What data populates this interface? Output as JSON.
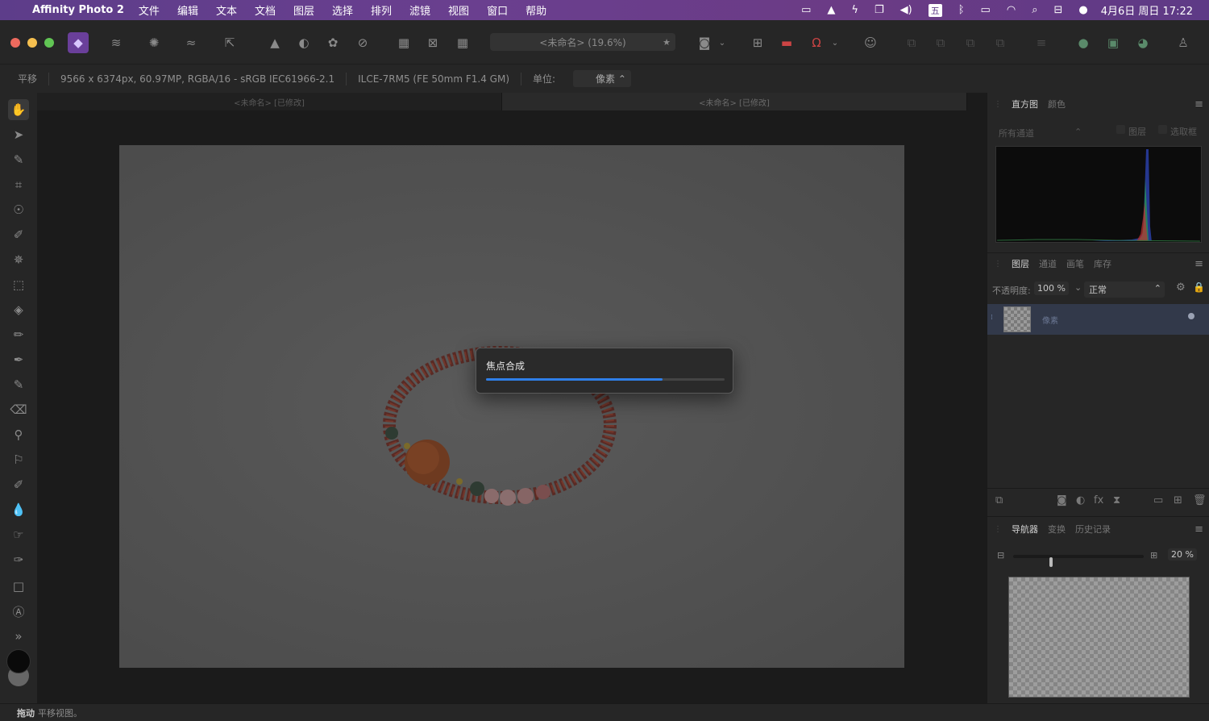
{
  "menubar": {
    "app_name": "Affinity Photo 2",
    "items": [
      "文件",
      "编辑",
      "文本",
      "文档",
      "图层",
      "选择",
      "排列",
      "滤镜",
      "视图",
      "窗口",
      "帮助"
    ],
    "input_method": "五",
    "clock": "4月6日 周日  17:22"
  },
  "toolbar": {
    "document_title": "<未命名> (19.6%)"
  },
  "contextbar": {
    "tool": "平移",
    "image_info": "9566 x 6374px, 60.97MP, RGBA/16 - sRGB IEC61966-2.1",
    "camera": "ILCE-7RM5 (FE 50mm F1.4 GM)",
    "unit_label": "单位:",
    "unit_value": "像素"
  },
  "doc_tabs": [
    "<未命名> [已修改]",
    "<未命名> [已修改]"
  ],
  "dialog": {
    "title": "焦点合成",
    "progress": 0.74
  },
  "panels": {
    "histogram": {
      "tabs": [
        "直方图",
        "颜色"
      ],
      "channel": "所有通道",
      "layer_check": "图层",
      "selection_check": "选取框"
    },
    "layers": {
      "tabs": [
        "图层",
        "通道",
        "画笔",
        "库存"
      ],
      "opacity_label": "不透明度:",
      "opacity_value": "100 %",
      "blend_mode": "正常",
      "layer_name": "像素"
    },
    "navigator": {
      "tabs": [
        "导航器",
        "变换",
        "历史记录"
      ],
      "zoom_value": "20 %"
    }
  },
  "statusbar": {
    "action": "拖动",
    "hint": "平移视图。"
  },
  "colors": {
    "menubar": "#653d8b",
    "progress": "#2f7fe8",
    "layer_selected": "#32394a",
    "close": "#ed6a5e",
    "minimize": "#f5bf4f",
    "zoom": "#61c554"
  }
}
